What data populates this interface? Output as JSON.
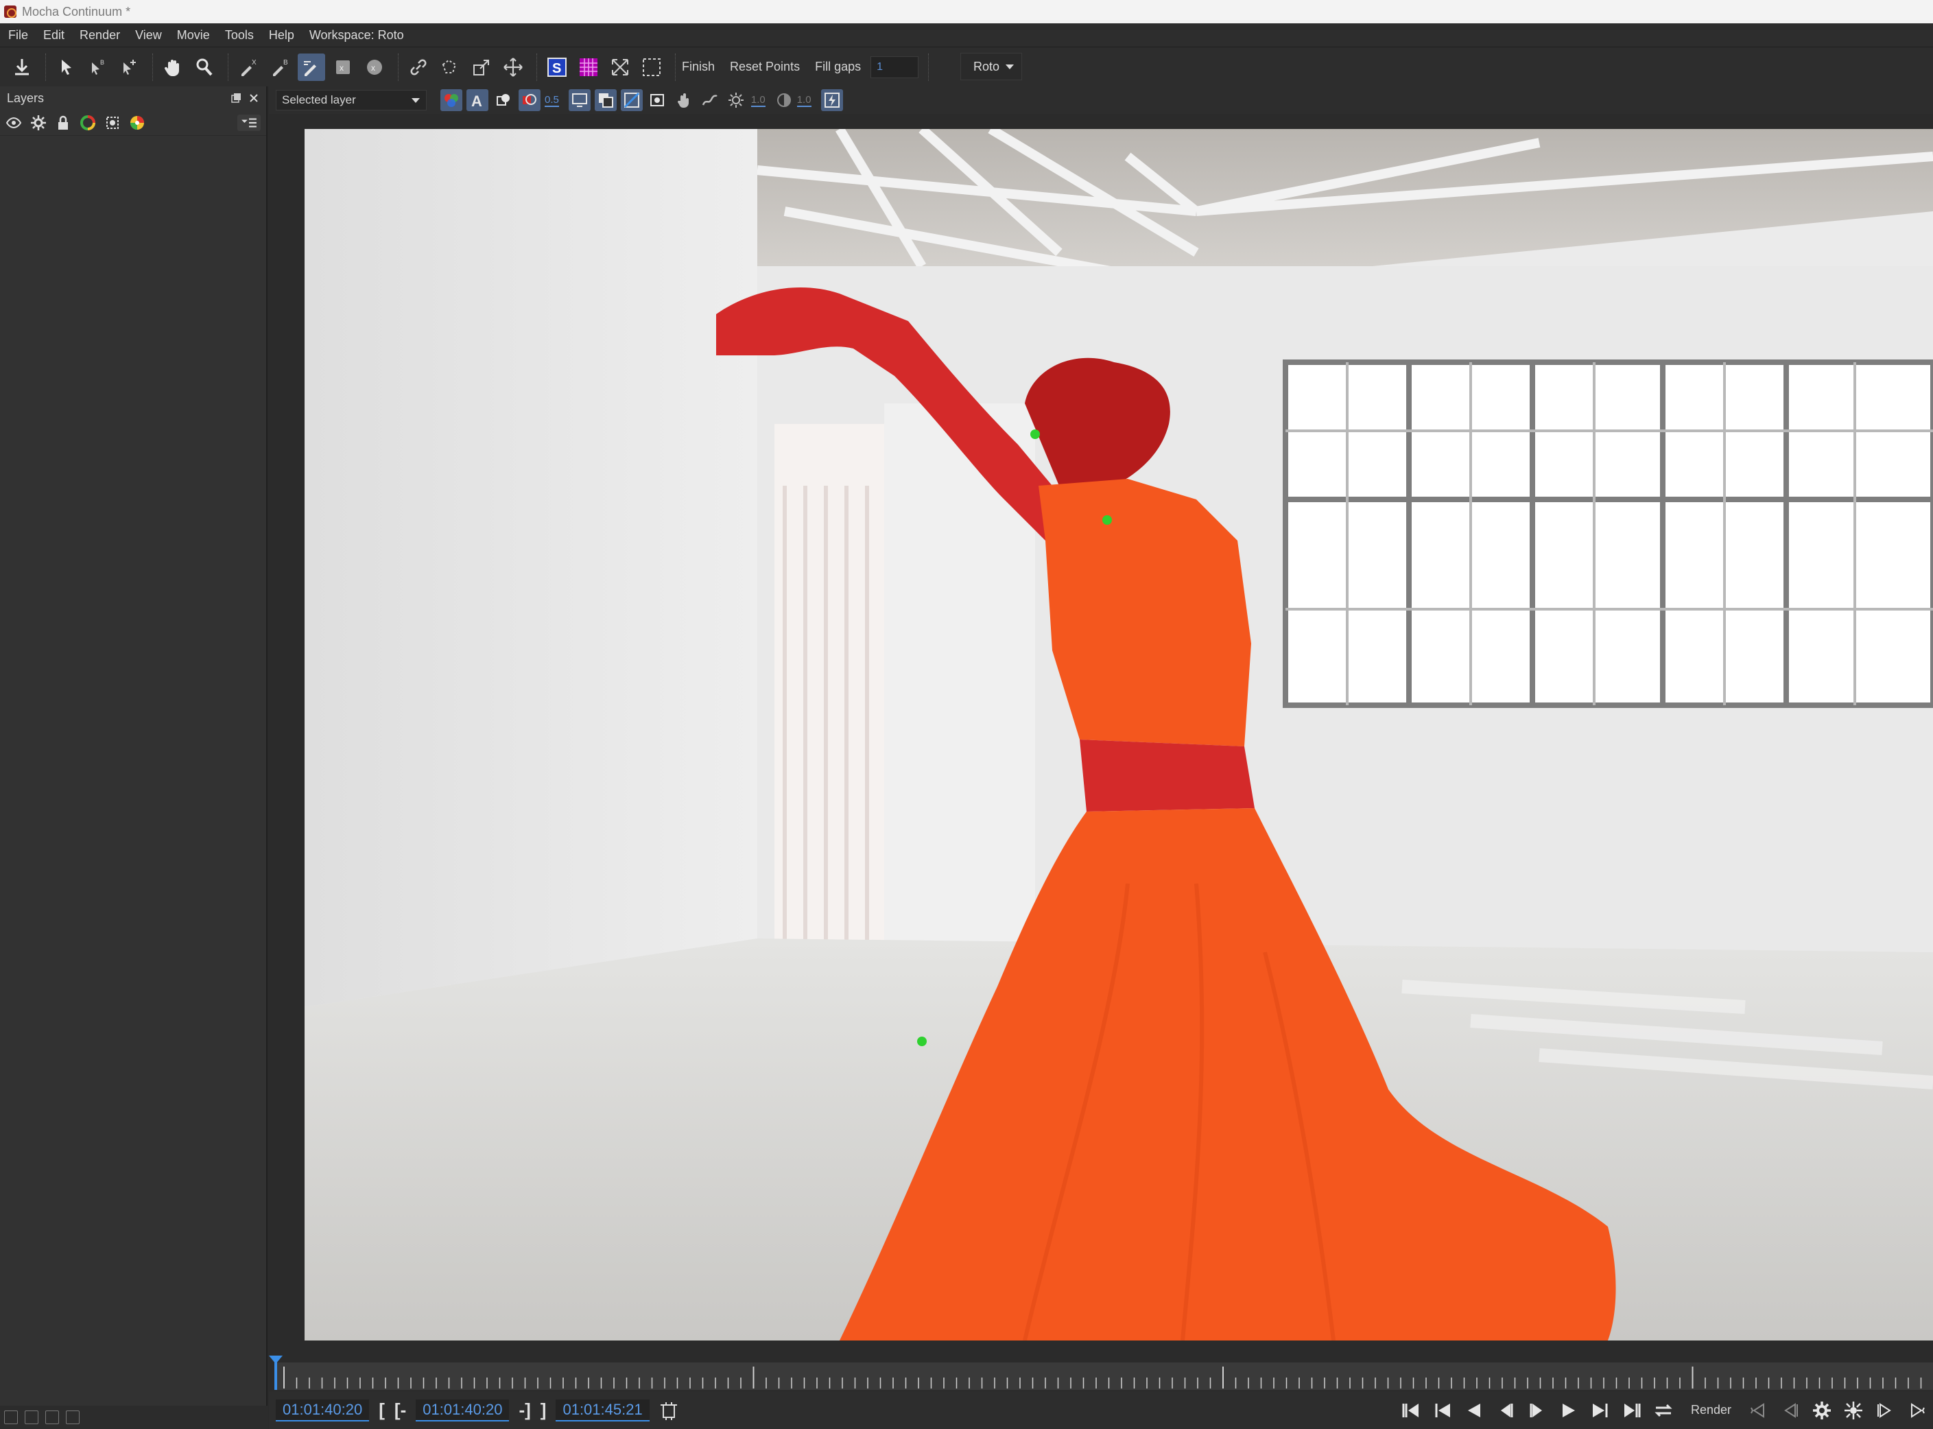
{
  "window": {
    "title": "Mocha Continuum *"
  },
  "menu": {
    "items": [
      "File",
      "Edit",
      "Render",
      "View",
      "Movie",
      "Tools",
      "Help",
      "Workspace: Roto"
    ]
  },
  "toolbar": {
    "finish_label": "Finish",
    "reset_points_label": "Reset Points",
    "fill_gaps_label": "Fill gaps",
    "fill_gaps_value": "1",
    "workspace_select": "Roto"
  },
  "layers_panel": {
    "title": "Layers"
  },
  "viewer_toolbar": {
    "layer_select": "Selected layer",
    "opacity_value": "0.5",
    "gain_value": "1.0",
    "contrast_value": "1.0"
  },
  "transport": {
    "current_time": "01:01:40:20",
    "in_point": "01:01:40:20",
    "out_point": "01:01:45:21",
    "render_label": "Render",
    "in_bracket": "[",
    "in_bracket_dash": "[-",
    "out_bracket_dash": "-]",
    "out_bracket": "]"
  },
  "colors": {
    "accent": "#3b8fe8",
    "matte_dress": "#f4571e",
    "matte_skin": "#d42a2a",
    "tracking_point": "#2fd12f"
  }
}
